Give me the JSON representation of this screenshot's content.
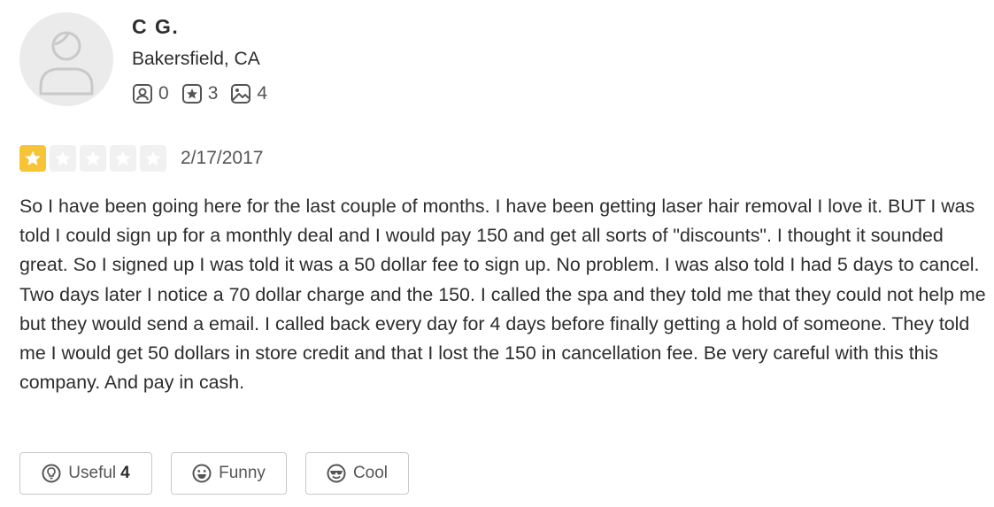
{
  "user": {
    "name": "C G.",
    "location": "Bakersfield, CA",
    "stats": [
      {
        "icon": "friends-icon",
        "value": "0"
      },
      {
        "icon": "reviews-star-icon",
        "value": "3"
      },
      {
        "icon": "photos-icon",
        "value": "4"
      }
    ]
  },
  "review": {
    "rating": 1,
    "max_rating": 5,
    "date": "2/17/2017",
    "text": "So I have been going here for the last couple of months. I have been getting laser hair removal I love it. BUT I was told I could sign up for a monthly deal and I would pay 150 and get all sorts of \"discounts\". I thought it sounded great. So I signed up I was told it was a 50 dollar fee to sign up. No problem. I was also told I had 5 days to cancel. Two days later I notice a 70 dollar charge and the 150. I called the spa and they told me that they could not help me but they would send a email. I called back every day for 4 days before finally getting a hold of someone. They told me I would get 50 dollars in store credit and that I lost the 150 in cancellation fee. Be very careful with this this company. And pay in cash."
  },
  "actions": {
    "useful_label": "Useful",
    "useful_count": "4",
    "funny_label": "Funny",
    "cool_label": "Cool"
  },
  "colors": {
    "star_filled": "#f7c435",
    "star_empty": "#f1f1f1",
    "text": "#2d2d2d",
    "muted": "#555555",
    "border": "#c9c9c9"
  }
}
